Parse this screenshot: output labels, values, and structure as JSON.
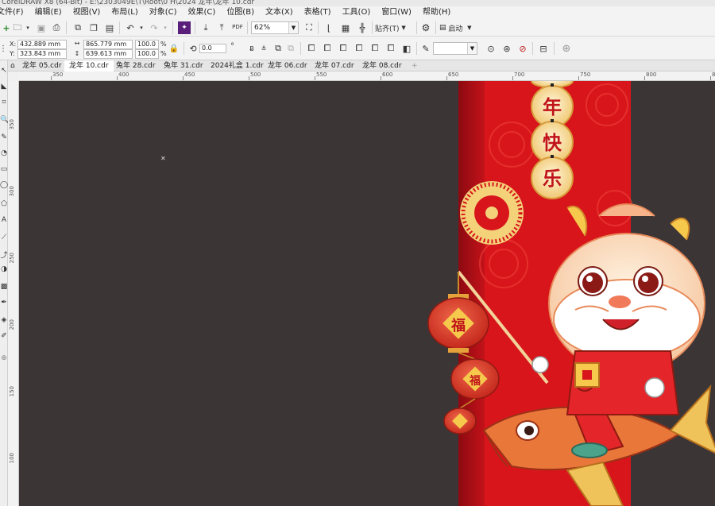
{
  "window": {
    "title": "CorelDRAW X8 (64-Bit) - E:\\2303049E\\T\\Root\\0 H\\2024 龙年\\龙年 10.cdr"
  },
  "menu": [
    {
      "label": "文件(F)"
    },
    {
      "label": "编辑(E)"
    },
    {
      "label": "视图(V)"
    },
    {
      "label": "布局(L)"
    },
    {
      "label": "对象(C)"
    },
    {
      "label": "效果(C)"
    },
    {
      "label": "位图(B)"
    },
    {
      "label": "文本(X)"
    },
    {
      "label": "表格(T)"
    },
    {
      "label": "工具(O)"
    },
    {
      "label": "窗口(W)"
    },
    {
      "label": "帮助(H)"
    }
  ],
  "toolbar": {
    "zoom": "62%",
    "snap_label": "贴齐(T)",
    "launch_label": "启动",
    "pdf_label": "PDF"
  },
  "property_bar": {
    "x_label": "X:",
    "x_value": "432.889 mm",
    "y_label": "Y:",
    "y_value": "323.843 mm",
    "w_value": "865.779 mm",
    "h_value": "639.613 mm",
    "scale_w": "100.0",
    "scale_h": "100.0",
    "percent": "%",
    "rotation": "0.0",
    "degree": "°"
  },
  "tabs": [
    {
      "label": "龙年 05.cdr",
      "active": false
    },
    {
      "label": "龙年 10.cdr",
      "active": true
    },
    {
      "label": "兔年 28.cdr",
      "active": false
    },
    {
      "label": "兔年 31.cdr",
      "active": false
    },
    {
      "label": "2024礼盒 1.cdr",
      "active": false
    },
    {
      "label": "龙年 06.cdr",
      "active": false
    },
    {
      "label": "龙年 07.cdr",
      "active": false
    },
    {
      "label": "龙年 08.cdr",
      "active": false
    }
  ],
  "ruler": {
    "top": [
      "350",
      "400",
      "450",
      "500",
      "550",
      "600",
      "650",
      "700",
      "750",
      "800",
      "850"
    ],
    "left": [
      "350",
      "300",
      "250",
      "200",
      "150",
      "100"
    ]
  },
  "artwork": {
    "couplet_chars": [
      "年",
      "快",
      "乐"
    ],
    "lantern_char": "福"
  },
  "colors": {
    "canvas": "#3b3635",
    "banner_red": "#d8151b",
    "gold": "#f3d27a"
  }
}
